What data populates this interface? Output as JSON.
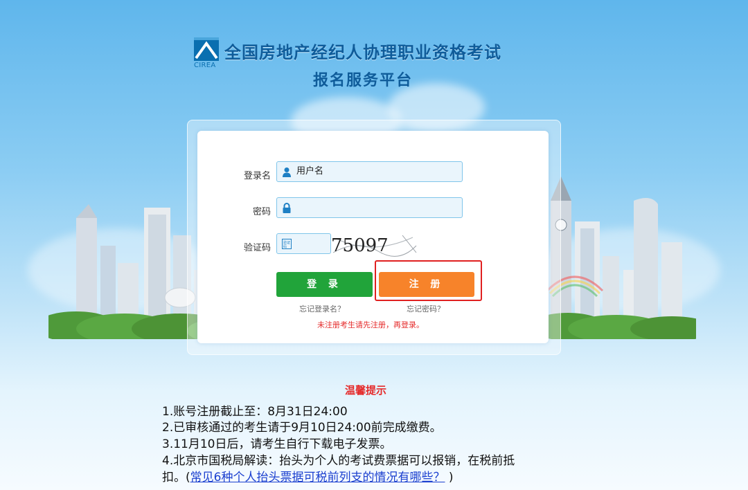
{
  "header": {
    "logo_text": "CIREA",
    "title_line1": "全国房地产经纪人协理职业资格考试",
    "title_line2": "报名服务平台"
  },
  "form": {
    "username_label": "登录名",
    "username_placeholder": "用户名",
    "password_label": "密码",
    "password_placeholder": "",
    "captcha_label": "验证码",
    "captcha_value": "",
    "captcha_text": "75097",
    "login_button": "登 录",
    "register_button": "注 册",
    "forgot_username": "忘记登录名？",
    "forgot_password": "忘记密码？",
    "register_notice": "未注册考生请先注册，再登录。"
  },
  "tips": {
    "title": "温馨提示",
    "items": [
      "1.账号注册截止至：8月31日24:00",
      "2.已审核通过的考生请于9月10日24:00前完成缴费。",
      "3.11月10日后，请考生自行下载电子发票。",
      "4.北京市国税局解读：抬头为个人的考试费票据可以报销，在税前抵"
    ],
    "item4_cont_prefix": "扣。(",
    "item4_link": "常见6种个人抬头票据可税前列支的情况有哪些？",
    "item4_cont_suffix": " )"
  },
  "icons": {
    "user": "user-icon",
    "lock": "lock-icon",
    "captcha": "captcha-icon",
    "logo": "cirea-logo-icon"
  },
  "colors": {
    "login_green": "#21a43a",
    "register_orange": "#f7832a",
    "title_blue": "#0f5c9a",
    "warning_red": "#e52a2a",
    "highlight_red": "#e02020",
    "link_blue": "#1a3fcf"
  }
}
